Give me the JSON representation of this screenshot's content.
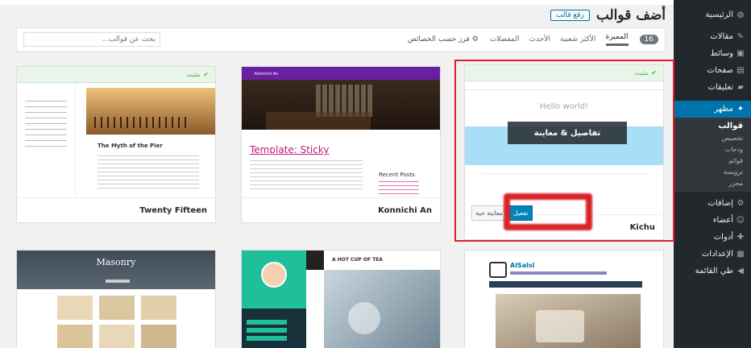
{
  "sidebar": {
    "items": [
      {
        "label": "الرئيسية",
        "icon": "dashboard-icon"
      },
      {
        "label": "مقالات",
        "icon": "pin-icon"
      },
      {
        "label": "وسائط",
        "icon": "media-icon"
      },
      {
        "label": "صفحات",
        "icon": "pages-icon"
      },
      {
        "label": "تعليقات",
        "icon": "comments-icon"
      },
      {
        "label": "مظهر",
        "icon": "appearance-icon"
      }
    ],
    "submenu": [
      "قوالب",
      "تخصيص",
      "ودجات",
      "قوائم",
      "ترويسة",
      "محرر"
    ],
    "items_after": [
      {
        "label": "إضافات",
        "icon": "plugins-icon"
      },
      {
        "label": "أعضاء",
        "icon": "users-icon"
      },
      {
        "label": "أدوات",
        "icon": "tools-icon"
      },
      {
        "label": "الإعدادات",
        "icon": "settings-icon"
      },
      {
        "label": "طي القائمة",
        "icon": "collapse-icon"
      }
    ]
  },
  "header": {
    "title": "أضف قوالب",
    "upload_label": "رفع قالب"
  },
  "filterbar": {
    "count": "16",
    "links": [
      "المميزة",
      "الأكثر شعبية",
      "الأحدث",
      "المفضلات"
    ],
    "feature_filter": "فرز حسب الخصائص",
    "search_placeholder": "بحث عن قوالب..."
  },
  "themes": [
    {
      "name": "Kichu",
      "installed_label": "مثبت",
      "details_label": "تفاصيل & معاينة",
      "activate_label": "تفعيل",
      "preview_label": "معاينة حية",
      "hello": "Hello world!"
    },
    {
      "name": "Konnichi An",
      "site_title": "Konnichi An",
      "post_title": "Template: Sticky",
      "widget_title": "Recent Posts"
    },
    {
      "name": "Twenty Fifteen",
      "installed_label": "مثبت",
      "post_title": "The Myth of the Pier"
    },
    {
      "name": "AlSalsl",
      "tagline": "AlSalsl"
    },
    {
      "name": "A HOT CUP OF TEA",
      "tagline": "A HOT CUP OF TEA"
    },
    {
      "name": "Masonry",
      "tagline": "Masonry"
    }
  ],
  "colors": {
    "admin_bg": "#23282d",
    "accent": "#0073aa",
    "highlight": "#d9232a",
    "konnichi_purple": "#6a1fa0",
    "teal": "#1fbf9b"
  }
}
